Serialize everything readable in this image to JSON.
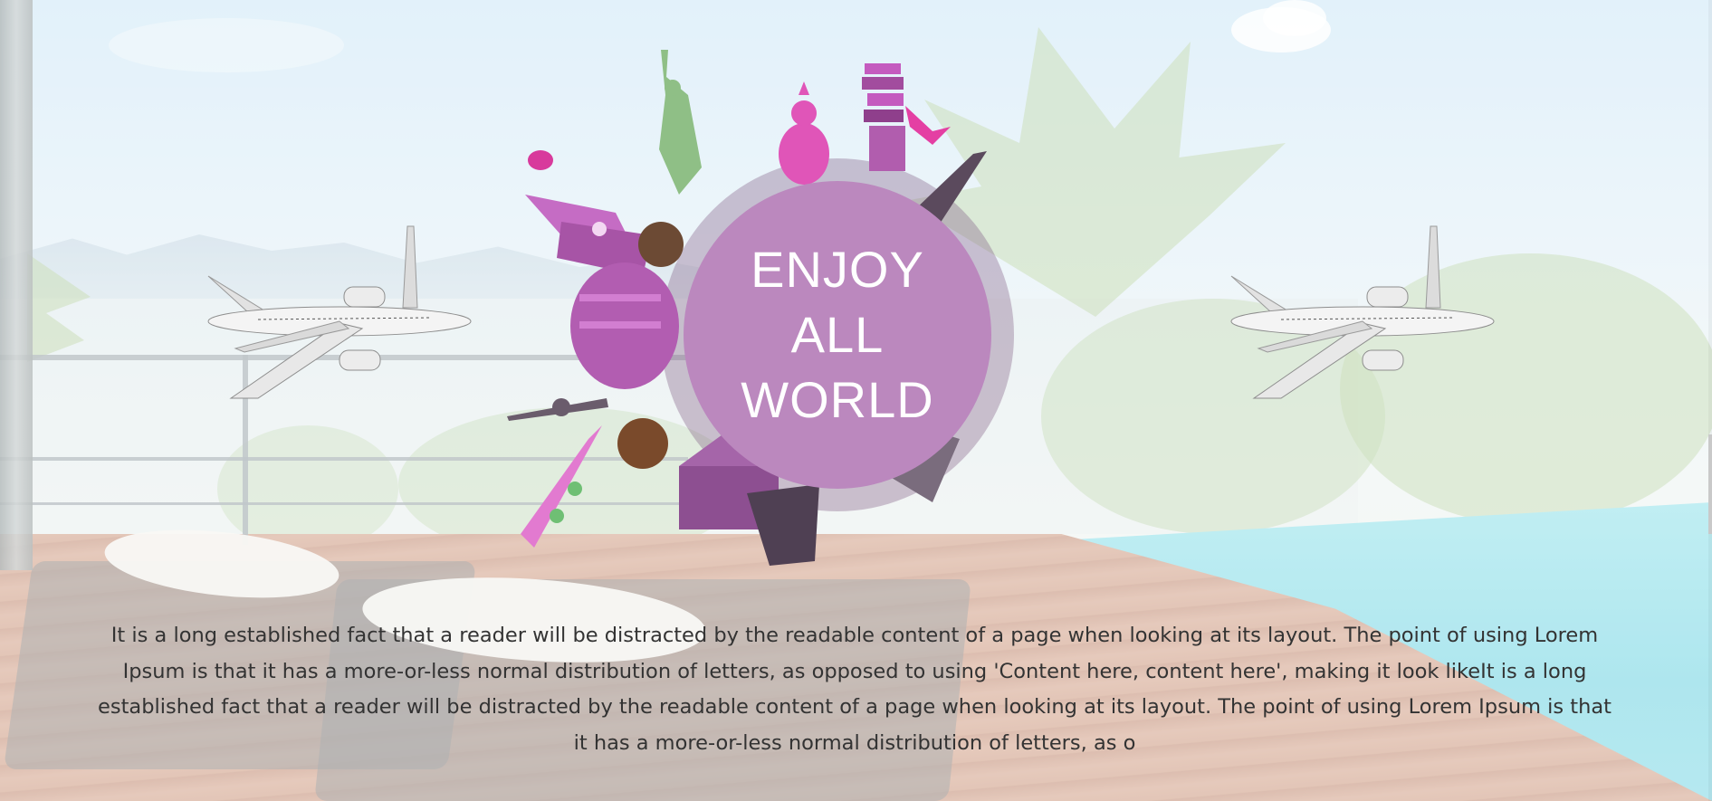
{
  "hero": {
    "title": "ENJOY\nALL\nWORLD",
    "circle_color": "#bb88be",
    "accent_color": "#c266c7"
  },
  "intro": {
    "text": "It is a long established fact that a reader will be distracted by the readable content of a page when looking at its layout. The point of using Lorem Ipsum is that it has a more-or-less normal distribution of letters, as opposed to using 'Content here, content here', making it look likeIt is a long established fact that a reader will be distracted by the readable content of a page when looking at its layout. The point of using Lorem Ipsum is that it has a more-or-less normal distribution of letters, as o"
  },
  "decor": {
    "left_icon": "airplane-icon",
    "right_icon": "airplane-icon",
    "landmarks": [
      "statue-of-liberty-icon",
      "buddha-icon",
      "big-ben-icon",
      "eiffel-tower-icon",
      "colosseum-icon",
      "leaning-tower-icon",
      "skyscraper-icon",
      "airplane-icon"
    ]
  }
}
